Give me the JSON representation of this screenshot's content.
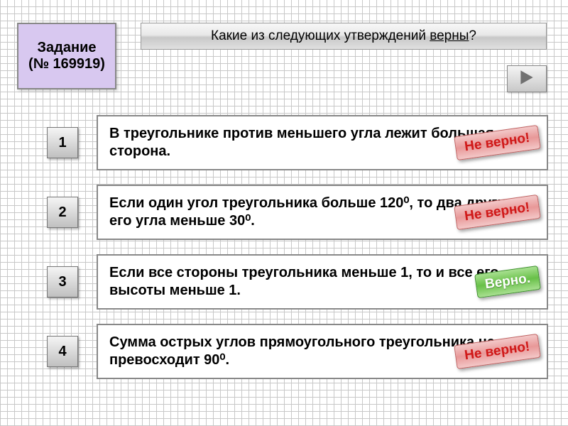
{
  "task": {
    "label_line1": "Задание",
    "label_line2": "(№ 169919)"
  },
  "question": {
    "prefix": "Какие из следующих утверждений ",
    "underlined": "верны",
    "suffix": "?"
  },
  "next_icon": "next-arrow",
  "statements": [
    {
      "num": "1",
      "text": "В треугольнике против меньшего угла лежит большая сторона.",
      "badge": {
        "text": "Не верно!",
        "kind": "wrong"
      }
    },
    {
      "num": "2",
      "text": "Если один угол треугольника больше 120⁰, то два других его угла меньше 30⁰.",
      "badge": {
        "text": "Не верно!",
        "kind": "wrong"
      }
    },
    {
      "num": "3",
      "text": "Если все стороны треугольника меньше 1, то и все его высоты меньше 1.",
      "badge": {
        "text": "Верно.",
        "kind": "right"
      }
    },
    {
      "num": "4",
      "text": "Сумма острых углов прямоугольного треугольника не превосходит 90⁰.",
      "badge": {
        "text": "Не верно!",
        "kind": "wrong"
      }
    }
  ]
}
